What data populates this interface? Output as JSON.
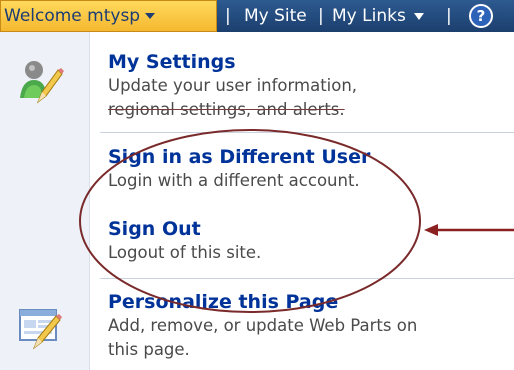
{
  "topbar": {
    "welcome": "Welcome mtysp",
    "separator": "|",
    "my_site": "My Site",
    "my_links": "My Links",
    "help_glyph": "?"
  },
  "menu": {
    "items": [
      {
        "title": "My Settings",
        "description_lines": [
          "Update your user information,",
          "regional settings, and alerts."
        ],
        "icon": "user-settings-icon"
      },
      {
        "title": "Sign in as Different User",
        "description_lines": [
          "Login with a different account."
        ]
      },
      {
        "title": "Sign Out",
        "description_lines": [
          "Logout of this site."
        ]
      },
      {
        "title": "Personalize this Page",
        "description_lines": [
          "Add, remove, or update Web Parts on",
          "this page."
        ],
        "icon": "personalize-page-icon"
      }
    ]
  },
  "colors": {
    "topbar": "#21497b",
    "welcome_bg": "#f5b830",
    "link": "#003399",
    "annotation": "#7a2a2a"
  }
}
